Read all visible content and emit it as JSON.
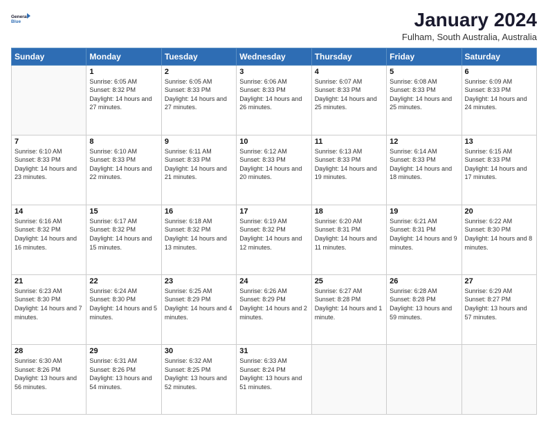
{
  "logo": {
    "line1": "General",
    "line2": "Blue"
  },
  "title": "January 2024",
  "subtitle": "Fulham, South Australia, Australia",
  "header_days": [
    "Sunday",
    "Monday",
    "Tuesday",
    "Wednesday",
    "Thursday",
    "Friday",
    "Saturday"
  ],
  "weeks": [
    [
      {
        "day": "",
        "sunrise": "",
        "sunset": "",
        "daylight": ""
      },
      {
        "day": "1",
        "sunrise": "Sunrise: 6:05 AM",
        "sunset": "Sunset: 8:32 PM",
        "daylight": "Daylight: 14 hours and 27 minutes."
      },
      {
        "day": "2",
        "sunrise": "Sunrise: 6:05 AM",
        "sunset": "Sunset: 8:33 PM",
        "daylight": "Daylight: 14 hours and 27 minutes."
      },
      {
        "day": "3",
        "sunrise": "Sunrise: 6:06 AM",
        "sunset": "Sunset: 8:33 PM",
        "daylight": "Daylight: 14 hours and 26 minutes."
      },
      {
        "day": "4",
        "sunrise": "Sunrise: 6:07 AM",
        "sunset": "Sunset: 8:33 PM",
        "daylight": "Daylight: 14 hours and 25 minutes."
      },
      {
        "day": "5",
        "sunrise": "Sunrise: 6:08 AM",
        "sunset": "Sunset: 8:33 PM",
        "daylight": "Daylight: 14 hours and 25 minutes."
      },
      {
        "day": "6",
        "sunrise": "Sunrise: 6:09 AM",
        "sunset": "Sunset: 8:33 PM",
        "daylight": "Daylight: 14 hours and 24 minutes."
      }
    ],
    [
      {
        "day": "7",
        "sunrise": "Sunrise: 6:10 AM",
        "sunset": "Sunset: 8:33 PM",
        "daylight": "Daylight: 14 hours and 23 minutes."
      },
      {
        "day": "8",
        "sunrise": "Sunrise: 6:10 AM",
        "sunset": "Sunset: 8:33 PM",
        "daylight": "Daylight: 14 hours and 22 minutes."
      },
      {
        "day": "9",
        "sunrise": "Sunrise: 6:11 AM",
        "sunset": "Sunset: 8:33 PM",
        "daylight": "Daylight: 14 hours and 21 minutes."
      },
      {
        "day": "10",
        "sunrise": "Sunrise: 6:12 AM",
        "sunset": "Sunset: 8:33 PM",
        "daylight": "Daylight: 14 hours and 20 minutes."
      },
      {
        "day": "11",
        "sunrise": "Sunrise: 6:13 AM",
        "sunset": "Sunset: 8:33 PM",
        "daylight": "Daylight: 14 hours and 19 minutes."
      },
      {
        "day": "12",
        "sunrise": "Sunrise: 6:14 AM",
        "sunset": "Sunset: 8:33 PM",
        "daylight": "Daylight: 14 hours and 18 minutes."
      },
      {
        "day": "13",
        "sunrise": "Sunrise: 6:15 AM",
        "sunset": "Sunset: 8:33 PM",
        "daylight": "Daylight: 14 hours and 17 minutes."
      }
    ],
    [
      {
        "day": "14",
        "sunrise": "Sunrise: 6:16 AM",
        "sunset": "Sunset: 8:32 PM",
        "daylight": "Daylight: 14 hours and 16 minutes."
      },
      {
        "day": "15",
        "sunrise": "Sunrise: 6:17 AM",
        "sunset": "Sunset: 8:32 PM",
        "daylight": "Daylight: 14 hours and 15 minutes."
      },
      {
        "day": "16",
        "sunrise": "Sunrise: 6:18 AM",
        "sunset": "Sunset: 8:32 PM",
        "daylight": "Daylight: 14 hours and 13 minutes."
      },
      {
        "day": "17",
        "sunrise": "Sunrise: 6:19 AM",
        "sunset": "Sunset: 8:32 PM",
        "daylight": "Daylight: 14 hours and 12 minutes."
      },
      {
        "day": "18",
        "sunrise": "Sunrise: 6:20 AM",
        "sunset": "Sunset: 8:31 PM",
        "daylight": "Daylight: 14 hours and 11 minutes."
      },
      {
        "day": "19",
        "sunrise": "Sunrise: 6:21 AM",
        "sunset": "Sunset: 8:31 PM",
        "daylight": "Daylight: 14 hours and 9 minutes."
      },
      {
        "day": "20",
        "sunrise": "Sunrise: 6:22 AM",
        "sunset": "Sunset: 8:30 PM",
        "daylight": "Daylight: 14 hours and 8 minutes."
      }
    ],
    [
      {
        "day": "21",
        "sunrise": "Sunrise: 6:23 AM",
        "sunset": "Sunset: 8:30 PM",
        "daylight": "Daylight: 14 hours and 7 minutes."
      },
      {
        "day": "22",
        "sunrise": "Sunrise: 6:24 AM",
        "sunset": "Sunset: 8:30 PM",
        "daylight": "Daylight: 14 hours and 5 minutes."
      },
      {
        "day": "23",
        "sunrise": "Sunrise: 6:25 AM",
        "sunset": "Sunset: 8:29 PM",
        "daylight": "Daylight: 14 hours and 4 minutes."
      },
      {
        "day": "24",
        "sunrise": "Sunrise: 6:26 AM",
        "sunset": "Sunset: 8:29 PM",
        "daylight": "Daylight: 14 hours and 2 minutes."
      },
      {
        "day": "25",
        "sunrise": "Sunrise: 6:27 AM",
        "sunset": "Sunset: 8:28 PM",
        "daylight": "Daylight: 14 hours and 1 minute."
      },
      {
        "day": "26",
        "sunrise": "Sunrise: 6:28 AM",
        "sunset": "Sunset: 8:28 PM",
        "daylight": "Daylight: 13 hours and 59 minutes."
      },
      {
        "day": "27",
        "sunrise": "Sunrise: 6:29 AM",
        "sunset": "Sunset: 8:27 PM",
        "daylight": "Daylight: 13 hours and 57 minutes."
      }
    ],
    [
      {
        "day": "28",
        "sunrise": "Sunrise: 6:30 AM",
        "sunset": "Sunset: 8:26 PM",
        "daylight": "Daylight: 13 hours and 56 minutes."
      },
      {
        "day": "29",
        "sunrise": "Sunrise: 6:31 AM",
        "sunset": "Sunset: 8:26 PM",
        "daylight": "Daylight: 13 hours and 54 minutes."
      },
      {
        "day": "30",
        "sunrise": "Sunrise: 6:32 AM",
        "sunset": "Sunset: 8:25 PM",
        "daylight": "Daylight: 13 hours and 52 minutes."
      },
      {
        "day": "31",
        "sunrise": "Sunrise: 6:33 AM",
        "sunset": "Sunset: 8:24 PM",
        "daylight": "Daylight: 13 hours and 51 minutes."
      },
      {
        "day": "",
        "sunrise": "",
        "sunset": "",
        "daylight": ""
      },
      {
        "day": "",
        "sunrise": "",
        "sunset": "",
        "daylight": ""
      },
      {
        "day": "",
        "sunrise": "",
        "sunset": "",
        "daylight": ""
      }
    ]
  ]
}
